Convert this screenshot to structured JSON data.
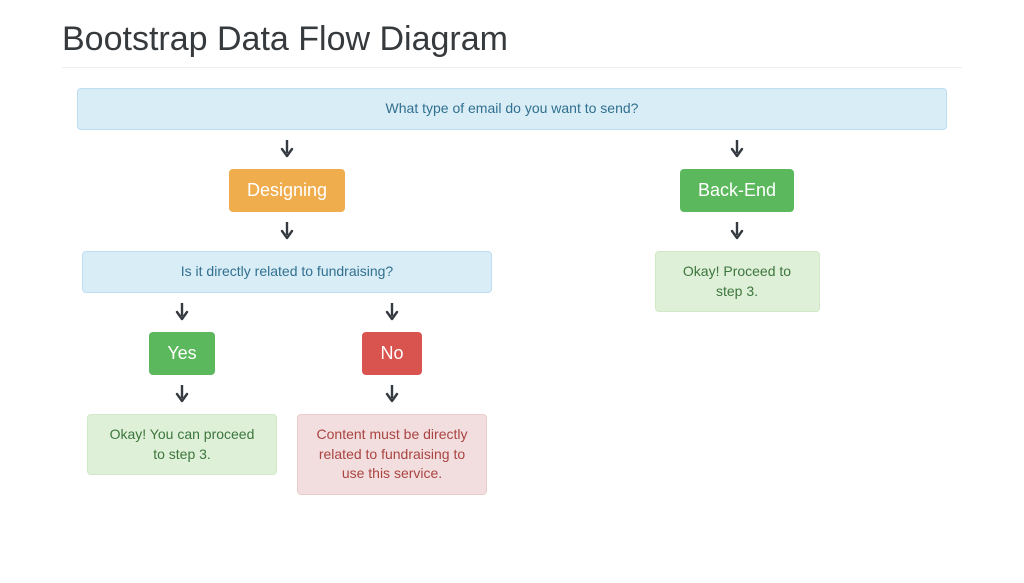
{
  "page_title": "Bootstrap Data Flow Diagram",
  "decision_root": "What type of email do you want to send?",
  "branches": {
    "left": {
      "label": "Designing",
      "sub_question": "Is it directly related to fundraising?",
      "yes": {
        "label": "Yes",
        "result": "Okay! You can proceed to step 3."
      },
      "no": {
        "label": "No",
        "result": "Content must be directly related to fundraising to use this service."
      }
    },
    "right": {
      "label": "Back-End",
      "result": "Okay! Proceed to step 3."
    }
  },
  "colors": {
    "info_bg": "#d9edf7",
    "info_fg": "#31708f",
    "warning": "#f0ad4e",
    "success": "#5cb85c",
    "danger": "#d9534f",
    "success_bg": "#dff0d8",
    "success_fg": "#3c763d",
    "danger_bg": "#f2dede",
    "danger_fg": "#a94442"
  }
}
